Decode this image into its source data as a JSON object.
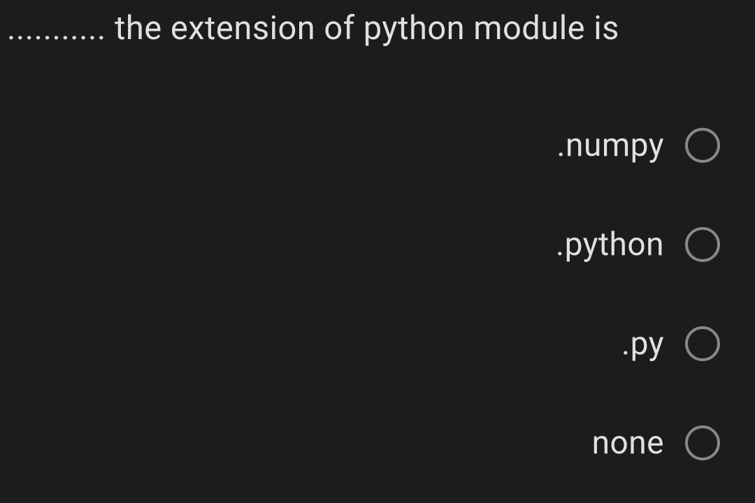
{
  "question": {
    "text": "........... the extension of python module is"
  },
  "options": [
    {
      "label": ".numpy",
      "selected": false
    },
    {
      "label": ".python",
      "selected": false
    },
    {
      "label": ".py",
      "selected": false
    },
    {
      "label": "none",
      "selected": false
    }
  ]
}
